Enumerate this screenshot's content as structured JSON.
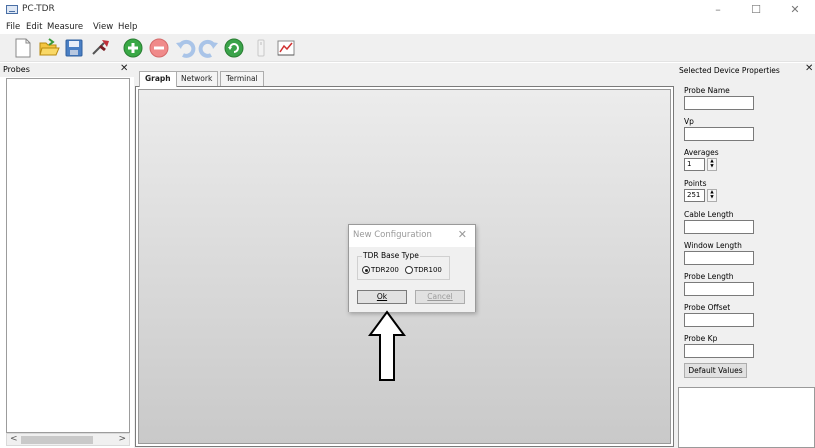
{
  "window": {
    "title": "PC-TDR",
    "min": "–",
    "max": "☐",
    "close": "✕"
  },
  "menu": {
    "items": [
      "File",
      "Edit",
      "Measure",
      "View",
      "Help"
    ]
  },
  "toolbar": {
    "buttons": [
      "new-file-icon",
      "open-folder-icon",
      "save-icon",
      "probe-icon",
      "add-icon",
      "remove-icon",
      "undo-icon",
      "redo-icon",
      "refresh-icon",
      "device-icon",
      "chart-icon"
    ]
  },
  "probes": {
    "title": "Probes",
    "close": "✕",
    "scroll_left": "<",
    "scroll_right": ">"
  },
  "tabs": [
    {
      "label": "Graph",
      "active": true
    },
    {
      "label": "Network",
      "active": false
    },
    {
      "label": "Terminal",
      "active": false
    }
  ],
  "dialog": {
    "title": "New Configuration",
    "close": "✕",
    "group_label": "TDR Base Type",
    "options": [
      {
        "label": "TDR200",
        "selected": true
      },
      {
        "label": "TDR100",
        "selected": false
      }
    ],
    "ok_label": "Ok",
    "cancel_label": "Cancel"
  },
  "properties": {
    "title": "Selected Device Properties",
    "close": "✕",
    "fields": [
      {
        "label": "Probe Name",
        "value": ""
      },
      {
        "label": "Vp",
        "value": ""
      },
      {
        "label": "Averages",
        "value": "1"
      },
      {
        "label": "Points",
        "value": "251"
      },
      {
        "label": "Cable Length",
        "value": ""
      },
      {
        "label": "Window Length",
        "value": ""
      },
      {
        "label": "Probe Length",
        "value": ""
      },
      {
        "label": "Probe Offset",
        "value": ""
      },
      {
        "label": "Probe Kp",
        "value": ""
      }
    ],
    "default_button": "Default Values",
    "spin_up": "▲",
    "spin_down": "▼"
  }
}
